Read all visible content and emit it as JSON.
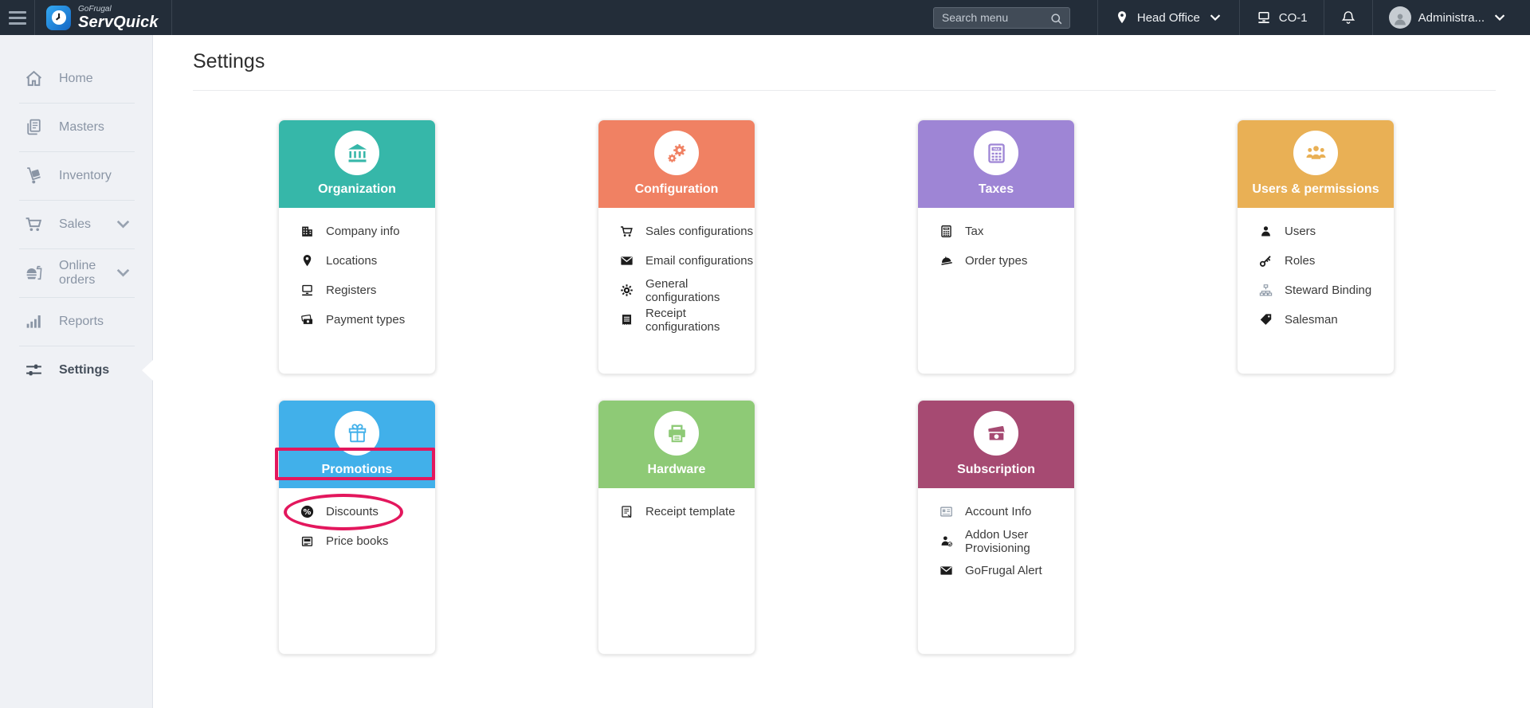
{
  "topbar": {
    "brand": {
      "name_top": "GoFrugal",
      "name_bottom": "ServQuick"
    },
    "search": {
      "placeholder": "Search menu"
    },
    "location": {
      "label": "Head Office"
    },
    "register": {
      "label": "CO-1"
    },
    "user": {
      "label": "Administra..."
    }
  },
  "sidebar": {
    "items": [
      {
        "label": "Home",
        "icon": "home-icon",
        "expandable": false,
        "active": false
      },
      {
        "label": "Masters",
        "icon": "masters-icon",
        "expandable": false,
        "active": false
      },
      {
        "label": "Inventory",
        "icon": "inventory-icon",
        "expandable": false,
        "active": false
      },
      {
        "label": "Sales",
        "icon": "sales-cart-icon",
        "expandable": true,
        "active": false
      },
      {
        "label": "Online orders",
        "icon": "online-orders-icon",
        "expandable": true,
        "active": false
      },
      {
        "label": "Reports",
        "icon": "reports-icon",
        "expandable": false,
        "active": false
      },
      {
        "label": "Settings",
        "icon": "settings-sliders-icon",
        "expandable": false,
        "active": true
      }
    ]
  },
  "page": {
    "title": "Settings"
  },
  "annotations": {
    "color": "#e3175d"
  },
  "cards": [
    {
      "title": "Organization",
      "color": "#36b7a9",
      "icon": "bank-icon",
      "items": [
        {
          "label": "Company info",
          "icon": "building-icon"
        },
        {
          "label": "Locations",
          "icon": "pin-icon"
        },
        {
          "label": "Registers",
          "icon": "register-icon"
        },
        {
          "label": "Payment types",
          "icon": "cash-icon"
        }
      ]
    },
    {
      "title": "Configuration",
      "color": "#f08163",
      "icon": "gears-icon",
      "items": [
        {
          "label": "Sales configurations",
          "icon": "cart-icon"
        },
        {
          "label": "Email configurations",
          "icon": "envelope-icon"
        },
        {
          "label": "General configurations",
          "icon": "gear-icon"
        },
        {
          "label": "Receipt configurations",
          "icon": "receipt-icon"
        }
      ]
    },
    {
      "title": "Taxes",
      "color": "#9e85d5",
      "icon": "tax-calculator-icon",
      "items": [
        {
          "label": "Tax",
          "icon": "tax-calculator-icon"
        },
        {
          "label": "Order types",
          "icon": "serving-dome-icon"
        }
      ]
    },
    {
      "title": "Users & permissions",
      "color": "#e9b055",
      "icon": "users-group-icon",
      "items": [
        {
          "label": "Users",
          "icon": "user-icon"
        },
        {
          "label": "Roles",
          "icon": "key-icon"
        },
        {
          "label": "Steward Binding",
          "icon": "hierarchy-icon",
          "muted": true
        },
        {
          "label": "Salesman",
          "icon": "tag-icon"
        }
      ]
    },
    {
      "title": "Promotions",
      "color": "#41b0ea",
      "icon": "gift-icon",
      "highlight": "rect",
      "items": [
        {
          "label": "Discounts",
          "icon": "discount-percent-icon",
          "highlight": "ellipse"
        },
        {
          "label": "Price books",
          "icon": "pricebook-icon"
        }
      ]
    },
    {
      "title": "Hardware",
      "color": "#8eca76",
      "icon": "printer-icon",
      "items": [
        {
          "label": "Receipt template",
          "icon": "receipt-template-icon"
        }
      ]
    },
    {
      "title": "Subscription",
      "color": "#a64a72",
      "icon": "money-icon",
      "items": [
        {
          "label": "Account Info",
          "icon": "account-info-icon",
          "muted": true
        },
        {
          "label": "Addon User Provisioning",
          "icon": "user-check-icon"
        },
        {
          "label": "GoFrugal Alert",
          "icon": "envelope-icon"
        }
      ]
    }
  ]
}
